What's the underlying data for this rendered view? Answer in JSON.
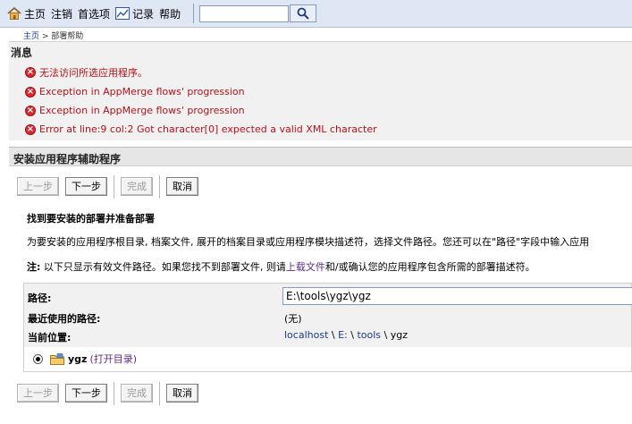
{
  "nav": {
    "home": "主页",
    "logout": "注销",
    "preferences": "首选项",
    "log": "记录",
    "help": "帮助",
    "search_value": ""
  },
  "breadcrumb": {
    "home": "主页",
    "separator": " > ",
    "current": "部署帮助"
  },
  "messages": {
    "title": "消息",
    "items": [
      "无法访问所选应用程序。",
      "Exception in AppMerge flows' progression",
      "Exception in AppMerge flows' progression",
      "Error at line:9 col:2 Got character[0] expected a valid XML character"
    ]
  },
  "wizard": {
    "title": "安装应用程序辅助程序",
    "buttons": {
      "prev": "上一步",
      "next": "下一步",
      "finish": "完成",
      "cancel": "取消"
    },
    "section_title": "找到要安装的部署并准备部署",
    "description": "为要安装的应用程序根目录, 档案文件, 展开的档案目录或应用程序模块描述符，选择文件路径。您还可以在\"路径\"字段中输入应用",
    "note_label": "注:",
    "note_part1": " 以下只显示有效文件路径。如果您找不到部署文件, 则请",
    "note_link": "上载文件",
    "note_part2": "和/或确认您的应用程序包含所需的部署描述符。"
  },
  "form": {
    "path_label": "路径:",
    "path_value": "E:\\tools\\ygz\\ygz",
    "recent_label": "最近使用的路径:",
    "recent_value": "(无)",
    "location_label": "当前位置:",
    "location": {
      "host": "localhost",
      "sep1": " \\ ",
      "drive": "E:",
      "sep2": " \\ ",
      "folder": "tools",
      "sep3": " \\ ",
      "current": "ygz"
    },
    "entry": {
      "name": "ygz",
      "open_dir": "(打开目录)"
    }
  },
  "colors": {
    "toolbar_bg": "#dfe7f4",
    "error_text": "#b4121a",
    "link": "#1a3a8a",
    "visited_link": "#5b2a86"
  }
}
